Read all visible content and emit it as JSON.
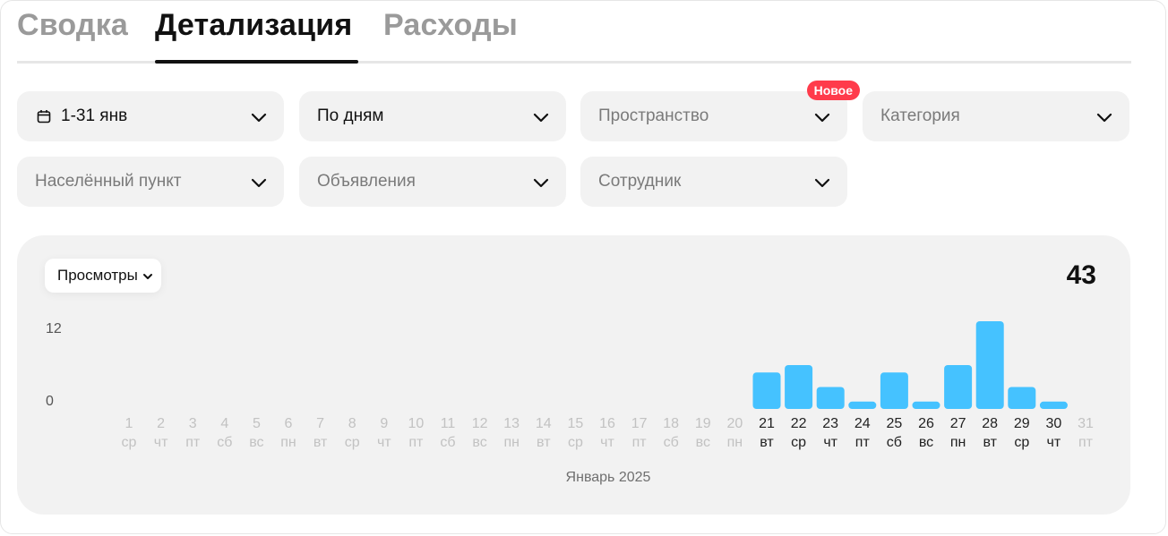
{
  "tabs": [
    {
      "label": "Сводка",
      "active": false
    },
    {
      "label": "Детализация",
      "active": true
    },
    {
      "label": "Расходы",
      "active": false
    }
  ],
  "filters": {
    "period": {
      "label": "1-31 янв",
      "icon": "calendar-icon"
    },
    "grouping": {
      "label": "По дням"
    },
    "space": {
      "label": "Пространство",
      "badge": "Новое"
    },
    "category": {
      "label": "Категория"
    },
    "locality": {
      "label": "Населённый пункт"
    },
    "listings": {
      "label": "Объявления"
    },
    "employee": {
      "label": "Сотрудник"
    }
  },
  "chart": {
    "metric_label": "Просмотры",
    "total": "43",
    "y_ticks": [
      "12",
      "0"
    ],
    "month_label": "Январь 2025"
  },
  "colors": {
    "bar": "#45c2ff",
    "badge": "#ff3b4b"
  },
  "chart_data": {
    "type": "bar",
    "categories": [
      "1",
      "2",
      "3",
      "4",
      "5",
      "6",
      "7",
      "8",
      "9",
      "10",
      "11",
      "12",
      "13",
      "14",
      "15",
      "16",
      "17",
      "18",
      "19",
      "20",
      "21",
      "22",
      "23",
      "24",
      "25",
      "26",
      "27",
      "28",
      "29",
      "30",
      "31"
    ],
    "weekdays": [
      "ср",
      "чт",
      "пт",
      "сб",
      "вс",
      "пн",
      "вт",
      "ср",
      "чт",
      "пт",
      "сб",
      "вс",
      "пн",
      "вт",
      "ср",
      "чт",
      "пт",
      "сб",
      "вс",
      "пн",
      "вт",
      "ср",
      "чт",
      "пт",
      "сб",
      "вс",
      "пн",
      "вт",
      "ср",
      "чт",
      "пт"
    ],
    "values": [
      0,
      0,
      0,
      0,
      0,
      0,
      0,
      0,
      0,
      0,
      0,
      0,
      0,
      0,
      0,
      0,
      0,
      0,
      0,
      0,
      5,
      6,
      3,
      1,
      5,
      1,
      6,
      12,
      3,
      1,
      0
    ],
    "ylim": [
      0,
      12
    ],
    "xlabel": "Январь 2025",
    "ylabel": "",
    "title": ""
  }
}
